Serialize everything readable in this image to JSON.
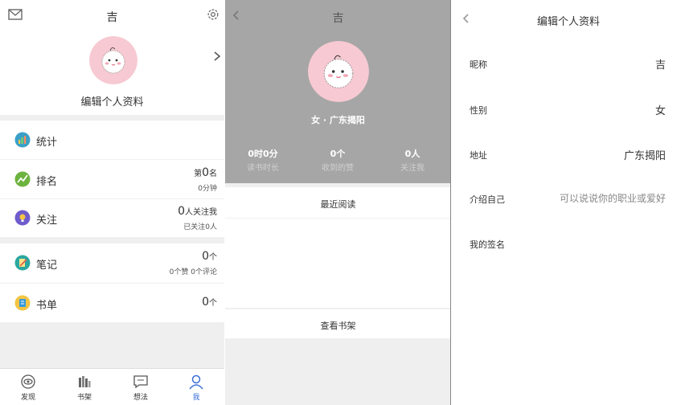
{
  "left_panel": {
    "title": "吉",
    "edit_profile": "编辑个人资料",
    "rows": [
      {
        "label": "统计"
      },
      {
        "label": "排名",
        "prefix": "第",
        "value": "0",
        "suffix": "名",
        "sub": "0分钟"
      },
      {
        "label": "关注",
        "value": "0",
        "suffix": "人关注我",
        "sub": "已关注0人"
      },
      {
        "label": "笔记",
        "value": "0",
        "suffix": "个",
        "sub": "0个赞 0个评论"
      },
      {
        "label": "书单",
        "value": "0",
        "suffix": "个"
      }
    ],
    "nav": [
      {
        "label": "发现"
      },
      {
        "label": "书架"
      },
      {
        "label": "想法"
      },
      {
        "label": "我"
      }
    ]
  },
  "middle_panel": {
    "title": "吉",
    "gender_location": "女 · 广东揭阳",
    "stats": [
      {
        "value": "0时0分",
        "label": "读书时长"
      },
      {
        "value": "0个",
        "label": "收到的赞"
      },
      {
        "value": "0人",
        "label": "关注我"
      }
    ],
    "recent_title": "最近阅读",
    "shelf_button": "查看书架"
  },
  "right_panel": {
    "title": "编辑个人资料",
    "fields": [
      {
        "label": "昵称",
        "value": "吉"
      },
      {
        "label": "性别",
        "value": "女"
      },
      {
        "label": "地址",
        "value": "广东揭阳"
      },
      {
        "label": "介绍自己",
        "placeholder": "可以说说你的职业或爱好"
      },
      {
        "label": "我的签名",
        "value": ""
      }
    ]
  },
  "colors": {
    "accent": "#3a6fd8",
    "header_gray": "#a6a6a6",
    "avatar_pink": "#f7c9d2"
  }
}
